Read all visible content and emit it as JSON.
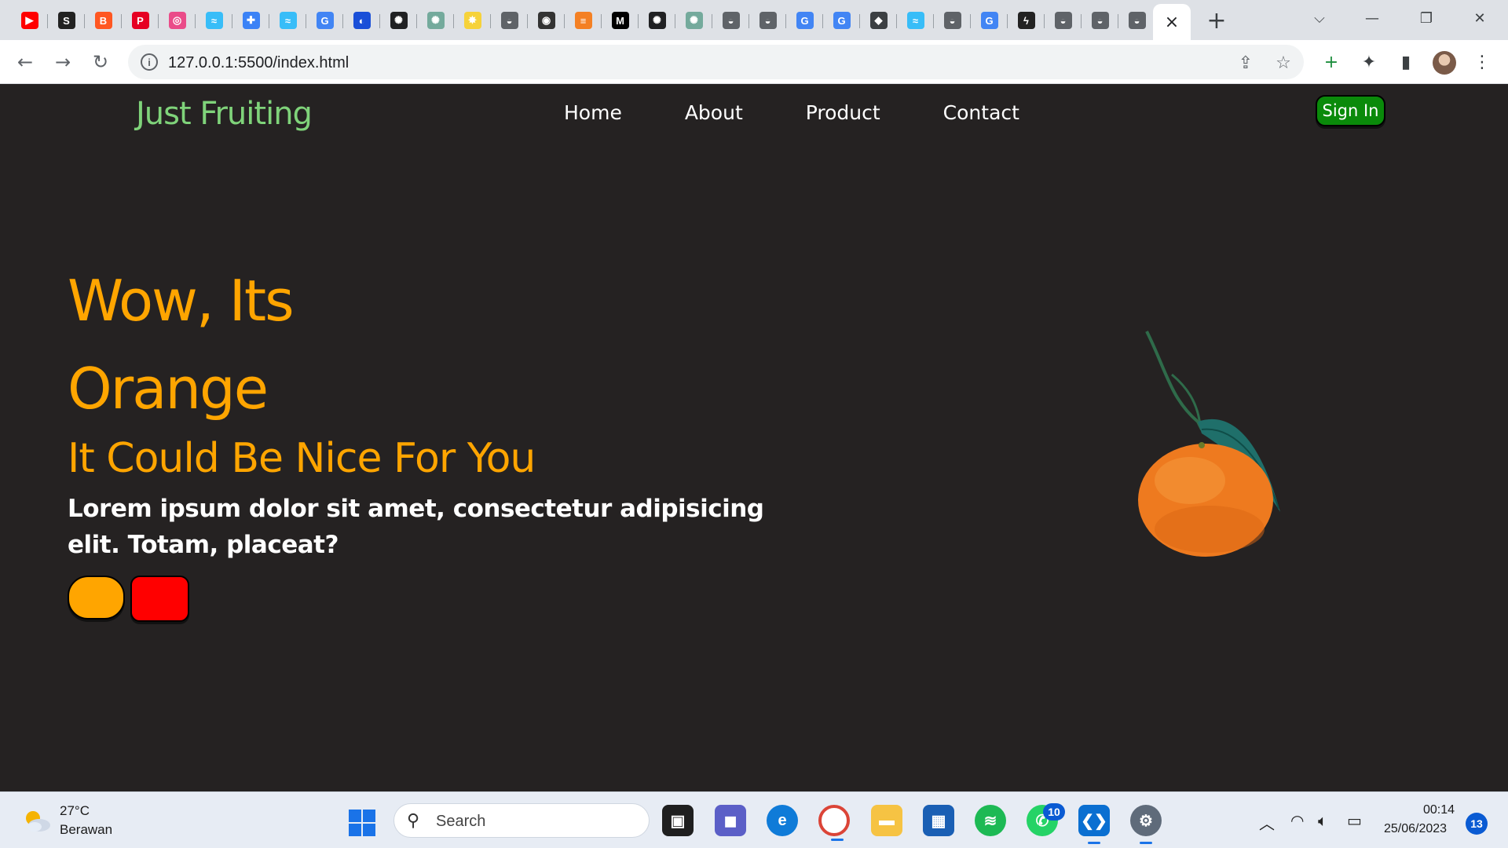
{
  "browser": {
    "tabs": [
      {
        "icon": "youtube-icon",
        "glyph": "▶",
        "color": "#ff0000"
      },
      {
        "icon": "document-icon",
        "glyph": "S",
        "color": "#222222"
      },
      {
        "icon": "blogger-icon",
        "glyph": "B",
        "color": "#ff5722"
      },
      {
        "icon": "pinterest-icon",
        "glyph": "P",
        "color": "#e60023"
      },
      {
        "icon": "dribbble-icon",
        "glyph": "◎",
        "color": "#ea4c89"
      },
      {
        "icon": "tailwind-icon",
        "glyph": "≈",
        "color": "#38bdf8"
      },
      {
        "icon": "puzzle-icon",
        "glyph": "✚",
        "color": "#3b82f6"
      },
      {
        "icon": "tailwind-icon",
        "glyph": "≈",
        "color": "#38bdf8"
      },
      {
        "icon": "google-icon",
        "glyph": "G",
        "color": "#4285f4"
      },
      {
        "icon": "globe-icon",
        "glyph": "◐",
        "color": "#1a4fd8"
      },
      {
        "icon": "chatgpt-icon",
        "glyph": "✺",
        "color": "#202123"
      },
      {
        "icon": "chatgpt-icon",
        "glyph": "✺",
        "color": "#74aa9c"
      },
      {
        "icon": "bulb-icon",
        "glyph": "✸",
        "color": "#f6d23a"
      },
      {
        "icon": "globe-icon",
        "glyph": "◒",
        "color": "#5f6368"
      },
      {
        "icon": "github-icon",
        "glyph": "◉",
        "color": "#333333"
      },
      {
        "icon": "stackoverflow-icon",
        "glyph": "≡",
        "color": "#f48024"
      },
      {
        "icon": "medium-icon",
        "glyph": "M",
        "color": "#000000"
      },
      {
        "icon": "chatgpt-icon",
        "glyph": "✺",
        "color": "#202123"
      },
      {
        "icon": "chatgpt-icon",
        "glyph": "✺",
        "color": "#74aa9c"
      },
      {
        "icon": "globe-icon",
        "glyph": "◒",
        "color": "#5f6368"
      },
      {
        "icon": "globe-icon",
        "glyph": "◒",
        "color": "#5f6368"
      },
      {
        "icon": "google-icon",
        "glyph": "G",
        "color": "#4285f4"
      },
      {
        "icon": "google-icon",
        "glyph": "G",
        "color": "#4285f4"
      },
      {
        "icon": "graduation-icon",
        "glyph": "◆",
        "color": "#3c4043"
      },
      {
        "icon": "tailwind-icon",
        "glyph": "≈",
        "color": "#38bdf8"
      },
      {
        "icon": "globe-icon",
        "glyph": "◒",
        "color": "#5f6368"
      },
      {
        "icon": "google-icon",
        "glyph": "G",
        "color": "#4285f4"
      },
      {
        "icon": "bolt-icon",
        "glyph": "ϟ",
        "color": "#222222"
      },
      {
        "icon": "globe-icon",
        "glyph": "◒",
        "color": "#5f6368"
      },
      {
        "icon": "globe-icon",
        "glyph": "◒",
        "color": "#5f6368"
      },
      {
        "icon": "globe-icon",
        "glyph": "◒",
        "color": "#5f6368"
      }
    ],
    "active_tab_close": "×",
    "new_tab": "+",
    "address": "127.0.0.1:5500/index.html"
  },
  "site": {
    "brand": "Just Fruiting",
    "nav": [
      "Home",
      "About",
      "Product",
      "Contact"
    ],
    "signin": "Sign In",
    "hero": {
      "title_line1": "Wow, Its",
      "title_line2": "Orange",
      "subtitle": "It Could Be Nice For You",
      "text": "Lorem ipsum dolor sit amet, consectetur adipisicing elit. Totam, placeat?"
    },
    "colors": {
      "background": "#252222",
      "brand": "#7fd37a",
      "accent": "#ffa500",
      "signin": "#0a8a0a",
      "red_button": "#ff0000"
    }
  },
  "taskbar": {
    "weather_temp": "27°C",
    "weather_desc": "Berawan",
    "search_label": "Search",
    "whatsapp_badge": "10",
    "time": "00:14",
    "date": "25/06/2023",
    "notifications": "13"
  }
}
